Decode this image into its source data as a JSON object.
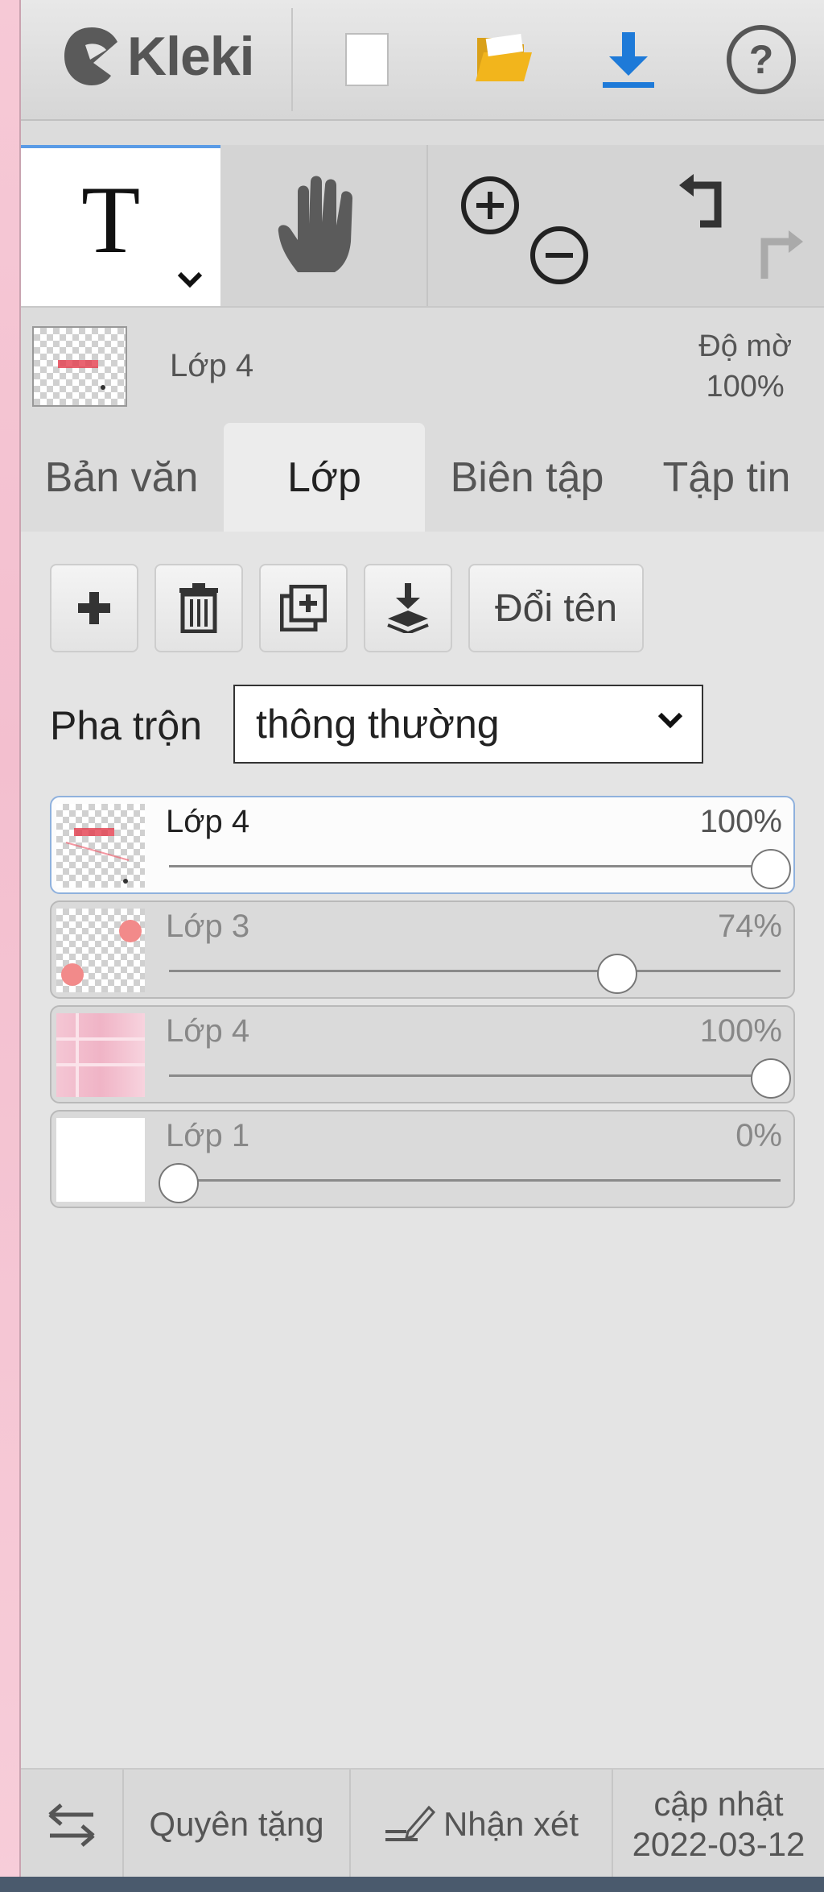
{
  "header": {
    "app_name": "Kleki",
    "new_icon": "new-document-icon",
    "open_icon": "folder-icon",
    "save_icon": "download-icon",
    "help_icon": "help-icon"
  },
  "tools": {
    "text_tool_glyph": "T",
    "hand_icon": "hand-icon",
    "zoom_in_icon": "zoom-in-icon",
    "zoom_out_icon": "zoom-out-icon",
    "undo_icon": "undo-icon",
    "redo_icon": "redo-icon"
  },
  "preview": {
    "layer_name": "Lớp 4",
    "opacity_label": "Độ mờ",
    "opacity_value": "100%"
  },
  "tabs": [
    {
      "label": "Bản văn",
      "active": false
    },
    {
      "label": "Lớp",
      "active": true
    },
    {
      "label": "Biên tập",
      "active": false
    },
    {
      "label": "Tập tin",
      "active": false
    }
  ],
  "layer_actions": {
    "rename_label": "Đổi tên"
  },
  "blend": {
    "label": "Pha trộn",
    "selected": "thông thường"
  },
  "layers": [
    {
      "name": "Lớp 4",
      "opacity_label": "100%",
      "opacity": 1.0,
      "selected": true
    },
    {
      "name": "Lớp 3",
      "opacity_label": "74%",
      "opacity": 0.74,
      "selected": false
    },
    {
      "name": "Lớp 4",
      "opacity_label": "100%",
      "opacity": 1.0,
      "selected": false
    },
    {
      "name": "Lớp 1",
      "opacity_label": "0%",
      "opacity": 0.0,
      "selected": false
    }
  ],
  "footer": {
    "donate_label": "Quyên tặng",
    "feedback_label": "Nhận xét",
    "update_label": "cập nhật",
    "update_date": "2022-03-12"
  },
  "colors": {
    "accent": "#1e7ad8",
    "folder": "#f2b51c",
    "selected_border": "#8fb1dd"
  }
}
